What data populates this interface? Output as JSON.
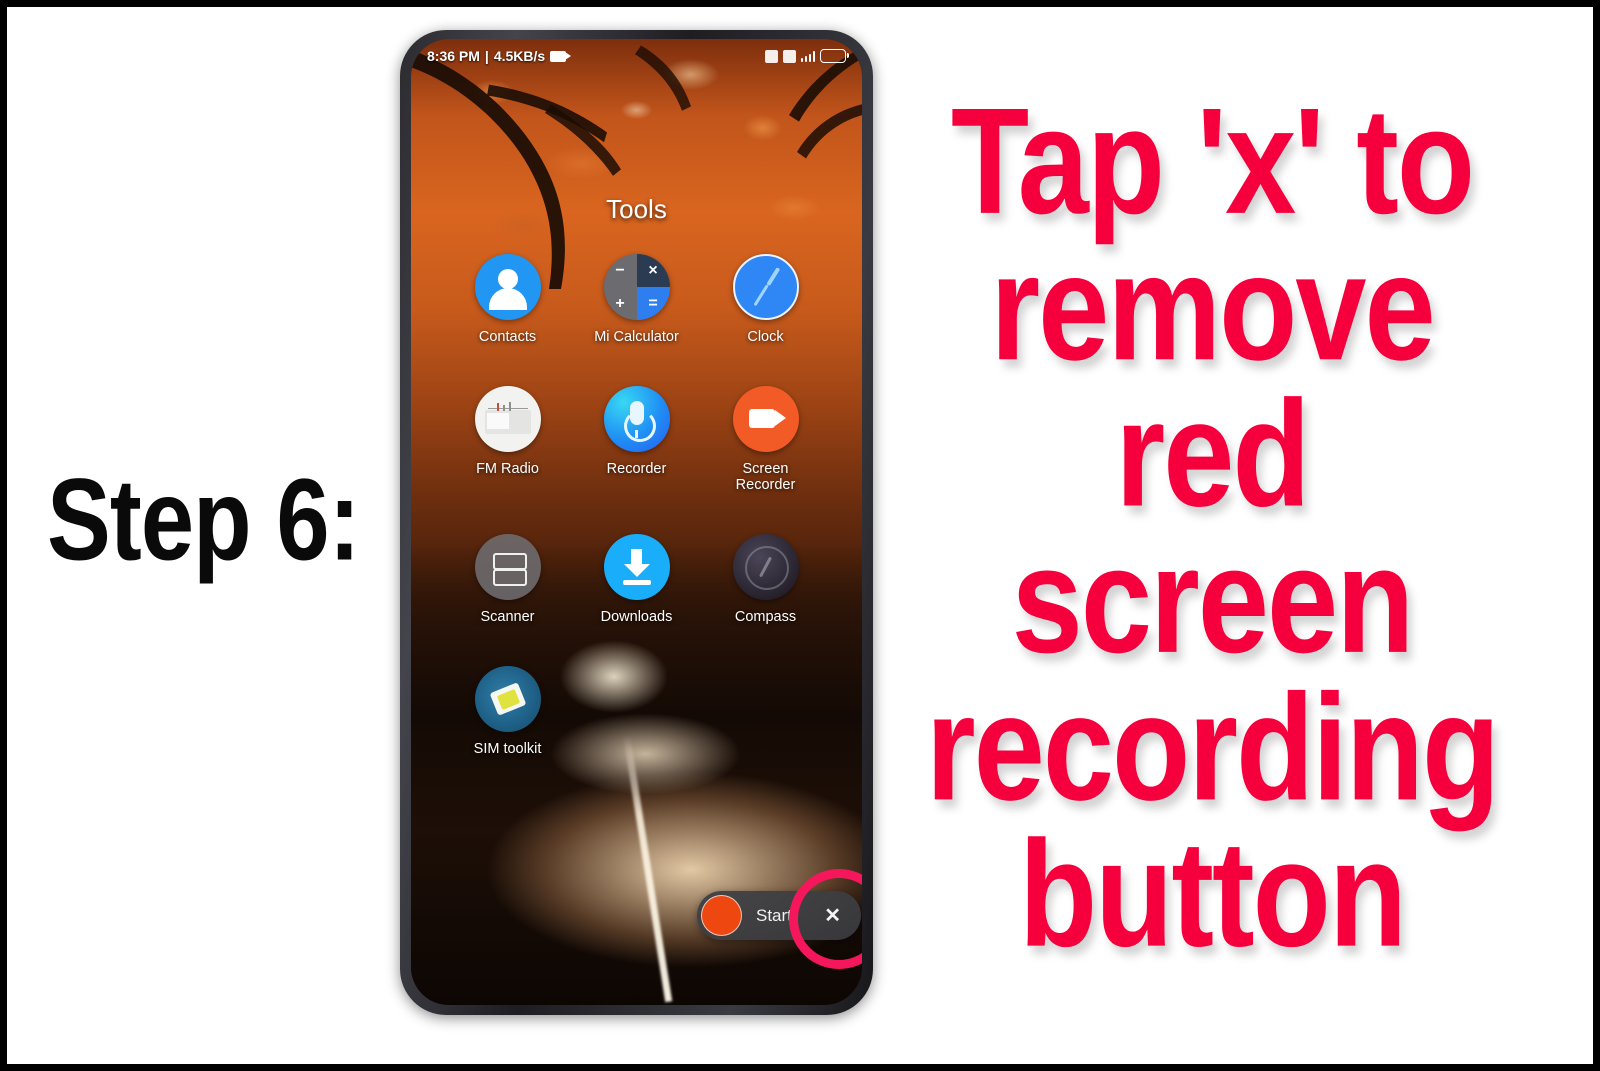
{
  "frame": {
    "border_color": "#000000",
    "background": "#ffffff"
  },
  "left_caption": {
    "text": "Step 6:",
    "color": "#0a0a0a"
  },
  "headline": {
    "color": "#f5003c",
    "lines": [
      "Tap 'x' to",
      "remove",
      "red",
      "screen",
      "recording",
      "button"
    ],
    "full_text": "Tap 'x' to remove red screen recording button"
  },
  "phone": {
    "statusbar": {
      "time": "8:36 PM",
      "separator": "|",
      "network_speed": "4.5KB/s",
      "recording_icon": "screen-recording-icon",
      "right_icons": [
        "notification-square-icon",
        "sim-square-icon",
        "signal-bars-icon",
        "battery-icon"
      ]
    },
    "folder": {
      "title": "Tools",
      "apps": [
        {
          "label": "Contacts",
          "icon": "contacts-icon"
        },
        {
          "label": "Mi Calculator",
          "icon": "calculator-icon"
        },
        {
          "label": "Clock",
          "icon": "clock-icon"
        },
        {
          "label": "FM Radio",
          "icon": "fm-radio-icon"
        },
        {
          "label": "Recorder",
          "icon": "microphone-icon"
        },
        {
          "label": "Screen\nRecorder",
          "icon": "screen-recorder-icon"
        },
        {
          "label": "Scanner",
          "icon": "scanner-icon"
        },
        {
          "label": "Downloads",
          "icon": "download-icon"
        },
        {
          "label": "Compass",
          "icon": "compass-icon"
        },
        {
          "label": "SIM toolkit",
          "icon": "sim-card-icon"
        }
      ]
    },
    "recorder_bar": {
      "record_button": "record-dot-button",
      "start_label": "Start",
      "close_label": "✕",
      "bar_color": "#3c3d42",
      "dot_color": "#ef4710"
    },
    "annotation": {
      "shape": "circle-highlight",
      "color": "#f5175c",
      "targets": "close-button"
    }
  }
}
